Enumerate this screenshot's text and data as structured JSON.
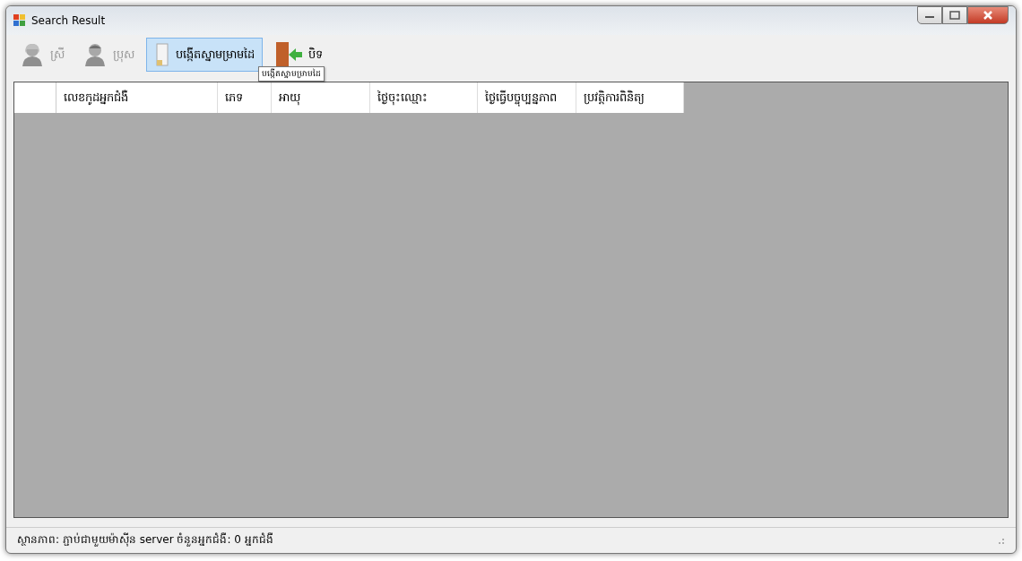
{
  "window": {
    "title": "Search Result"
  },
  "toolbar": [
    {
      "kind": "female",
      "label": "ស្រី",
      "selected": false,
      "disabled": true
    },
    {
      "kind": "male",
      "label": "ប្រុស",
      "selected": false,
      "disabled": true
    },
    {
      "kind": "fingerprint",
      "label": "បង្កើតស្នាមម្រាមដៃ",
      "selected": true,
      "disabled": false
    },
    {
      "kind": "exit",
      "label": "បិទ",
      "selected": false,
      "disabled": false
    }
  ],
  "tooltip": "បង្កើតស្នាមម្រាមដៃ",
  "table": {
    "columns": [
      "លេខកូដអ្នកជំងឺ",
      "ភេទ",
      "អាយុ",
      "ថ្ងៃចុះឈ្មោះ",
      "ថ្ងៃធ្វើបច្ចុប្បន្នភាព",
      "ប្រវត្តិការពិនិត្យ"
    ]
  },
  "status_bar": "ស្ថានភាព: ភ្ជាប់ជាមួយម៉ាស៊ីន server  ចំនួនអ្នកជំងឺ: 0 អ្នកជំងឺ"
}
